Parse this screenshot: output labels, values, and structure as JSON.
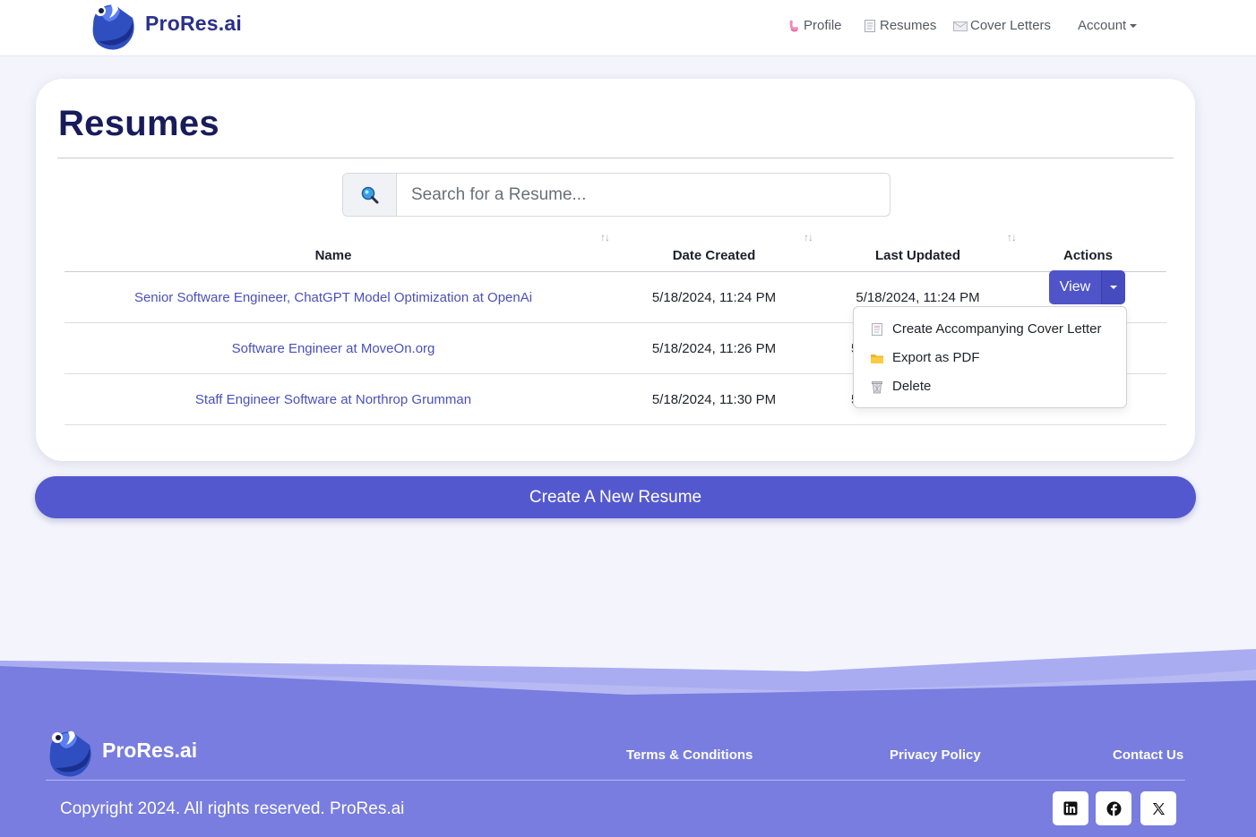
{
  "brand": {
    "name": "ProRes.ai"
  },
  "nav": {
    "items": [
      {
        "label": "Profile",
        "icon": "arm-icon"
      },
      {
        "label": "Resumes",
        "icon": "page-icon"
      },
      {
        "label": "Cover Letters",
        "icon": "envelope-icon"
      },
      {
        "label": "Account",
        "icon": "caret-down-icon"
      }
    ]
  },
  "page": {
    "title": "Resumes"
  },
  "search": {
    "placeholder": "Search for a Resume...",
    "value": ""
  },
  "table": {
    "columns": [
      "Name",
      "Date Created",
      "Last Updated",
      "Actions"
    ],
    "sort_glyph": "↑↓",
    "rows": [
      {
        "name": "Senior Software Engineer, ChatGPT Model Optimization at OpenAi",
        "created": "5/18/2024, 11:24 PM",
        "updated": "5/18/2024, 11:24 PM"
      },
      {
        "name": "Software Engineer at MoveOn.org",
        "created": "5/18/2024, 11:26 PM",
        "updated": "5"
      },
      {
        "name": "Staff Engineer Software at Northrop Grumman",
        "created": "5/18/2024, 11:30 PM",
        "updated": "5"
      }
    ]
  },
  "actions": {
    "view_label": "View",
    "menu": [
      {
        "label": "Create Accompanying Cover Letter",
        "icon": "page-icon"
      },
      {
        "label": "Export as PDF",
        "icon": "folder-icon"
      },
      {
        "label": "Delete",
        "icon": "wastebasket-icon"
      }
    ]
  },
  "create_button": {
    "label": "Create A New Resume"
  },
  "footer": {
    "brand": "ProRes.ai",
    "links": [
      "Terms & Conditions",
      "Privacy Policy",
      "Contact Us"
    ],
    "copyright": "Copyright 2024. All rights reserved. ProRes.ai",
    "social": [
      "linkedin-icon",
      "facebook-icon",
      "x-icon"
    ]
  },
  "colors": {
    "primary": "#5458cf",
    "brand_text": "#2b2f8c",
    "title": "#181c5a",
    "link": "#4a50bc",
    "footer_bg": "#787ddf",
    "page_bg": "#f4f5fc"
  }
}
